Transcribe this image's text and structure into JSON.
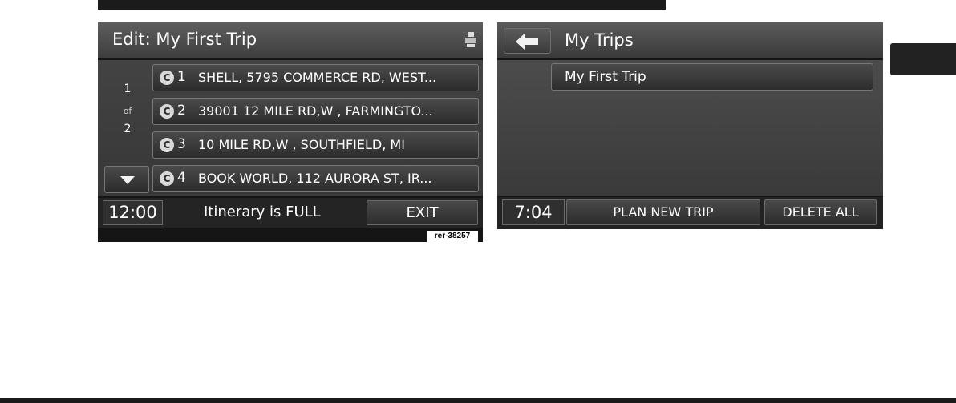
{
  "edit_screen": {
    "title": "Edit: My First Trip",
    "icon": "printer-icon",
    "page_indicator": {
      "current": "1",
      "of": "of",
      "total": "2"
    },
    "waypoints": [
      {
        "number": "1",
        "address": "SHELL, 5795 COMMERCE RD, WEST..."
      },
      {
        "number": "2",
        "address": "39001 12 MILE RD,W , FARMINGTO..."
      },
      {
        "number": "3",
        "address": "10 MILE RD,W , SOUTHFIELD, MI"
      },
      {
        "number": "4",
        "address": "BOOK WORLD, 112 AURORA ST, IR..."
      }
    ],
    "waypoint_icon_glyph": "C",
    "clock": "12:00",
    "status": "Itinerary is FULL",
    "exit_label": "EXIT",
    "ref_label": "rer-38257"
  },
  "trips_screen": {
    "title": "My Trips",
    "trips": [
      "My First Trip"
    ],
    "clock": "7:04",
    "plan_label": "PLAN NEW TRIP",
    "delete_label": "DELETE ALL"
  }
}
